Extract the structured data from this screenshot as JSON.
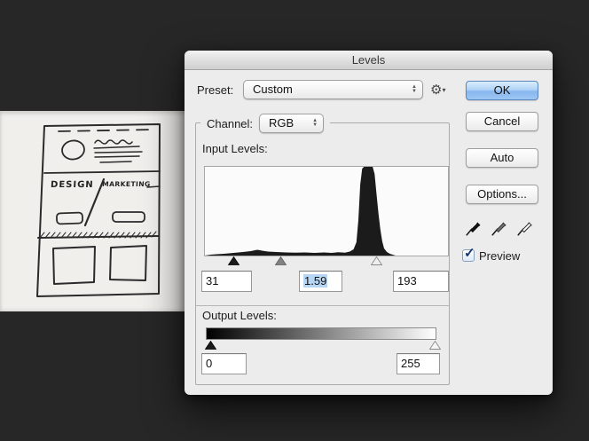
{
  "window": {
    "title": "Levels"
  },
  "preset": {
    "label": "Preset:",
    "value": "Custom"
  },
  "channel": {
    "label": "Channel:",
    "value": "RGB"
  },
  "input_levels": {
    "label": "Input Levels:",
    "shadow": "31",
    "gamma": "1.59",
    "highlight": "193"
  },
  "output_levels": {
    "label": "Output Levels:",
    "black": "0",
    "white": "255"
  },
  "buttons": {
    "ok": "OK",
    "cancel": "Cancel",
    "auto": "Auto",
    "options": "Options..."
  },
  "preview": {
    "label": "Preview",
    "checked": true
  },
  "icons": {
    "gear": "⚙",
    "gear_caret": "▾",
    "popup_up": "▲",
    "popup_down": "▼",
    "check": "✓"
  },
  "eyedroppers": [
    "black-point",
    "gray-point",
    "white-point"
  ],
  "sliders": {
    "input_shadow": 49,
    "input_gamma": 102,
    "input_highlight": 210,
    "output_black": 23,
    "output_white": 276
  },
  "colors": {
    "workspace_background": "#272727",
    "paper": "#f1efec",
    "dialog_background": "#ececec",
    "ok_button_blue": "#9dc6f3",
    "selection_highlight": "#b6d6f3",
    "histogram_fill": "#1b1b1b"
  },
  "histogram": {
    "range": [
      0,
      255
    ],
    "points": [
      [
        0,
        0
      ],
      [
        6,
        0.01
      ],
      [
        12,
        0.015
      ],
      [
        20,
        0.02
      ],
      [
        30,
        0.03
      ],
      [
        40,
        0.04
      ],
      [
        48,
        0.05
      ],
      [
        55,
        0.065
      ],
      [
        60,
        0.055
      ],
      [
        66,
        0.045
      ],
      [
        75,
        0.04
      ],
      [
        85,
        0.035
      ],
      [
        95,
        0.032
      ],
      [
        105,
        0.035
      ],
      [
        115,
        0.03
      ],
      [
        125,
        0.035
      ],
      [
        133,
        0.03
      ],
      [
        140,
        0.038
      ],
      [
        147,
        0.032
      ],
      [
        152,
        0.045
      ],
      [
        156,
        0.07
      ],
      [
        159,
        0.15
      ],
      [
        161,
        0.4
      ],
      [
        163,
        0.8
      ],
      [
        165,
        0.98
      ],
      [
        167,
        1
      ],
      [
        176,
        1
      ],
      [
        178,
        0.92
      ],
      [
        180,
        0.7
      ],
      [
        182,
        0.48
      ],
      [
        184,
        0.3
      ],
      [
        186,
        0.16
      ],
      [
        188,
        0.08
      ],
      [
        191,
        0.04
      ],
      [
        194,
        0.02
      ],
      [
        197,
        0.01
      ],
      [
        200,
        0
      ],
      [
        255,
        0
      ]
    ]
  },
  "sketch": {
    "left_label": "DESIGN",
    "right_label": "MARKETING"
  }
}
